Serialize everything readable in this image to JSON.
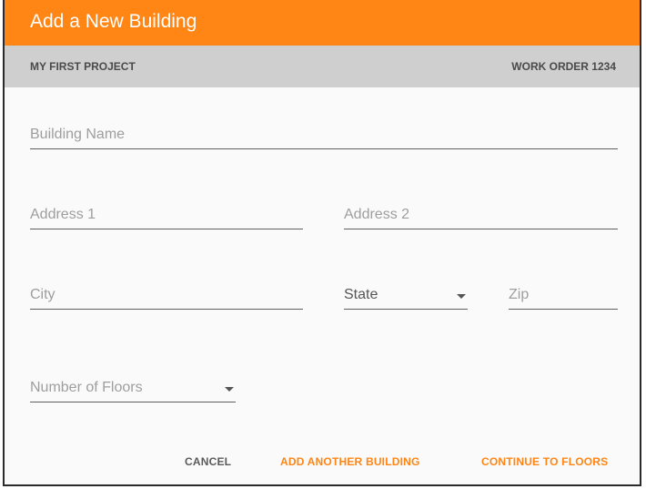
{
  "dialog": {
    "title": "Add a New Building",
    "project": "MY FIRST PROJECT",
    "work_order": "WORK ORDER 1234"
  },
  "form": {
    "building_name_placeholder": "Building Name",
    "address1_placeholder": "Address 1",
    "address2_placeholder": "Address 2",
    "city_placeholder": "City",
    "state_label": "State",
    "zip_placeholder": "Zip",
    "floors_label": "Number of Floors"
  },
  "actions": {
    "cancel": "CANCEL",
    "add_another": "ADD ANOTHER BUILDING",
    "continue": "CONTINUE TO FLOORS"
  },
  "colors": {
    "accent": "#ff8514",
    "subbar": "#cfcfcf",
    "muted_text": "#9e9e9e"
  },
  "icons": {
    "dropdown": "chevron-down-icon"
  }
}
